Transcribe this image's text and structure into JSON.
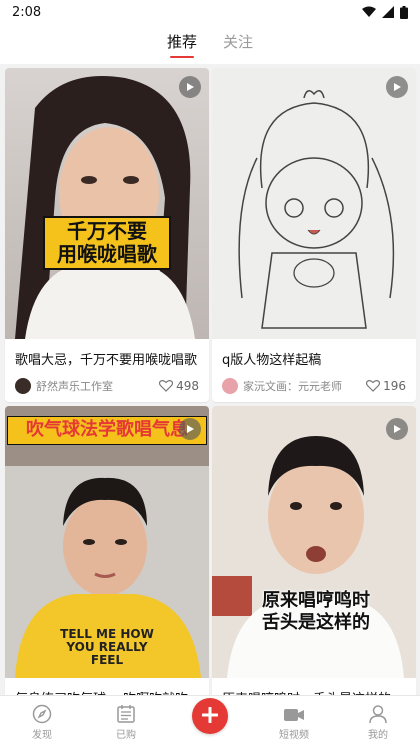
{
  "status": {
    "time": "2:08"
  },
  "tabs": [
    {
      "label": "推荐"
    },
    {
      "label": "关注"
    }
  ],
  "cards": [
    {
      "thumb_caption_line1": "千万不要",
      "thumb_caption_line2": "用喉咙唱歌",
      "title": "歌唱大忌，千万不要用喉咙唱歌",
      "author": "舒然声乐工作室",
      "likes": "498"
    },
    {
      "title": "q版人物这样起稿",
      "author": "家沅文画：元元老师",
      "likes": "196"
    },
    {
      "thumb_caption": "吹气球法学歌唱气息",
      "thumb_shirt_text": "TELL ME HOW YOU REALLY FEEL",
      "title": "气息练习吹气球， 吹啊吹就吹"
    },
    {
      "thumb_caption_line1": "原来唱哼鸣时",
      "thumb_caption_line2": "舌头是这样的",
      "title": "原来唱哼鸣时，舌头是这样的"
    }
  ],
  "nav": [
    {
      "label": "发现",
      "icon": "compass-icon"
    },
    {
      "label": "已购",
      "icon": "calendar-icon"
    },
    {
      "label": "",
      "icon": "plus-icon"
    },
    {
      "label": "短视频",
      "icon": "video-camera-icon"
    },
    {
      "label": "我的",
      "icon": "person-icon"
    }
  ],
  "colors": {
    "accent": "#e53935",
    "caption_yellow": "#f4c21a"
  }
}
